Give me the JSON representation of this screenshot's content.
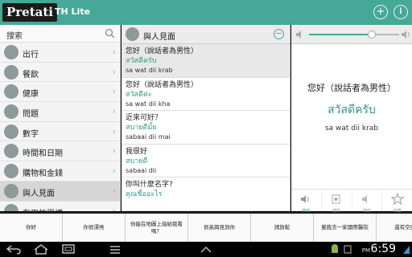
{
  "app": {
    "logo_text": "Pretati",
    "title": "TH Lite",
    "colors": {
      "accent": "#46a896",
      "thai_text": "#2e9b85"
    }
  },
  "sidebar": {
    "search_label": "搜索",
    "items": [
      {
        "label": "出行",
        "icon": "car-icon"
      },
      {
        "label": "餐飲",
        "icon": "food-icon"
      },
      {
        "label": "健康",
        "icon": "health-icon"
      },
      {
        "label": "問題",
        "icon": "question-icon"
      },
      {
        "label": "數字",
        "icon": "numbers-icon"
      },
      {
        "label": "時間和日期",
        "icon": "clock-icon"
      },
      {
        "label": "購物和金錢",
        "icon": "shopping-icon"
      },
      {
        "label": "與人見面",
        "icon": "people-icon",
        "selected": true
      },
      {
        "label": "有用的單詞",
        "icon": "book-icon"
      }
    ]
  },
  "middle": {
    "title": "與人見面",
    "phrases": [
      {
        "native": "您好（說話者為男性）",
        "thai": "สวัสดีครับ",
        "roman": "sa wat dii krab",
        "selected": true
      },
      {
        "native": "您好（說話者為男性）",
        "thai": "สวัสดีค่ะ",
        "roman": "sa wat dii kha"
      },
      {
        "native": "近來可好？",
        "thai": "สบายดีมั้ย",
        "roman": "sabaai dii mai"
      },
      {
        "native": "我很好",
        "thai": "สบายดี",
        "roman": "sabaai dii"
      },
      {
        "native": "你叫什麼名字?",
        "thai": "คุณชื่ออะไร",
        "roman": ""
      }
    ]
  },
  "detail": {
    "native": "您好（說話者為男性）",
    "thai": "สวัสดีครับ",
    "roman": "sa wat dii krab",
    "volume_level": 0.7,
    "actions": [
      {
        "label": "播放",
        "icon": "speaker-icon",
        "accent": true
      },
      {
        "label": "錄製",
        "icon": "record-icon"
      },
      {
        "label": "播放",
        "icon": "playback-icon"
      },
      {
        "label": "收藏",
        "icon": "star-icon"
      }
    ]
  },
  "quick_phrases": [
    "你好",
    "你很漂亮",
    "你能在地圖上指給我看嗎？",
    "很高興見到你",
    "請放鬆",
    "載我去一家國際醫院",
    "還有空房間"
  ],
  "system": {
    "time": "6:59",
    "ampm": "PM"
  }
}
